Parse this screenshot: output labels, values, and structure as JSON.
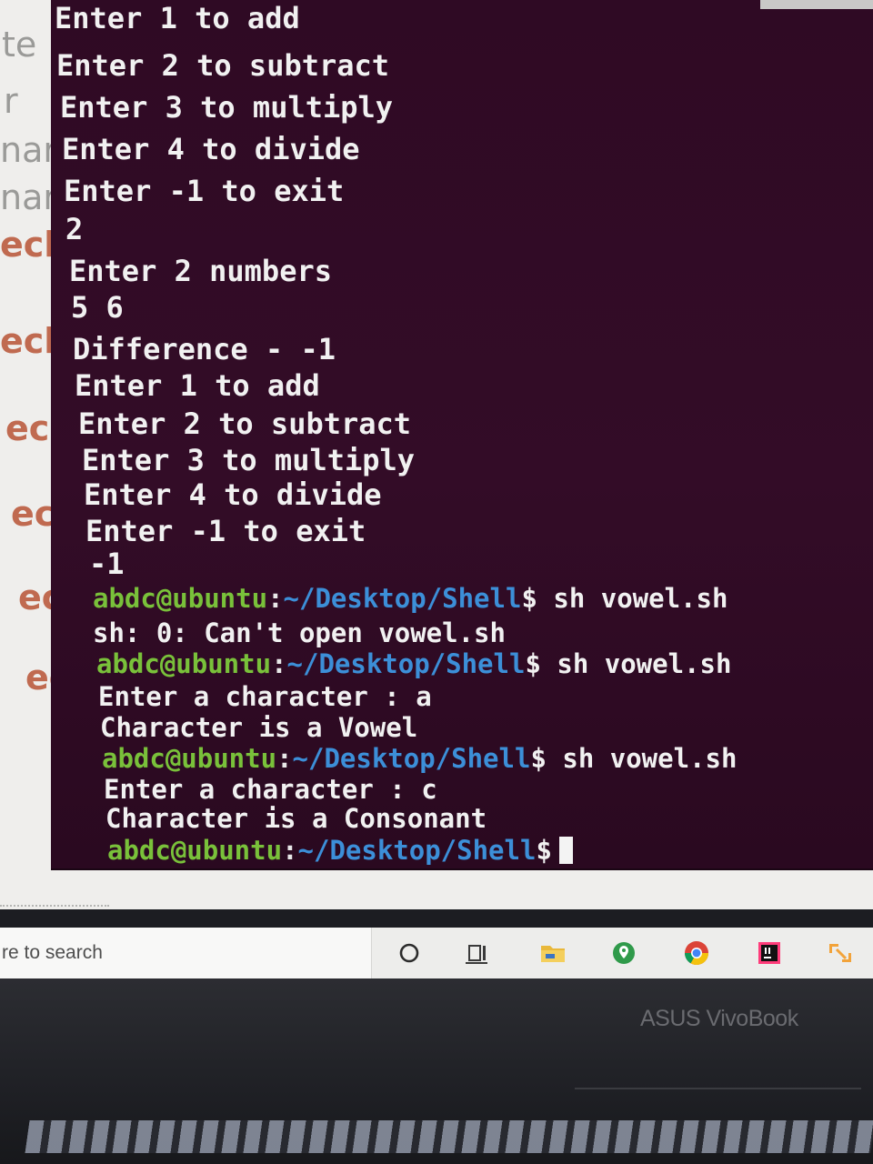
{
  "editor_fragments": [
    {
      "text": "te",
      "kind": "plain"
    },
    {
      "text": "r",
      "kind": "plain"
    },
    {
      "text": "nar",
      "kind": "plain"
    },
    {
      "text": "nar",
      "kind": "plain"
    },
    {
      "text": "ech",
      "kind": "echo"
    },
    {
      "text": "ech",
      "kind": "echo"
    },
    {
      "text": "ech",
      "kind": "echo"
    },
    {
      "text": "ech",
      "kind": "echo"
    },
    {
      "text": "ech",
      "kind": "echo"
    },
    {
      "text": "ech",
      "kind": "echo"
    }
  ],
  "terminal": {
    "lines": [
      {
        "type": "text",
        "text": "Enter 1 to add"
      },
      {
        "type": "text",
        "text": "Enter 2 to subtract"
      },
      {
        "type": "text",
        "text": "Enter 3 to multiply"
      },
      {
        "type": "text",
        "text": "Enter 4 to divide"
      },
      {
        "type": "text",
        "text": "Enter -1 to exit"
      },
      {
        "type": "text",
        "text": "2"
      },
      {
        "type": "text",
        "text": "Enter 2 numbers"
      },
      {
        "type": "text",
        "text": "5 6"
      },
      {
        "type": "text",
        "text": "Difference - -1"
      },
      {
        "type": "text",
        "text": "Enter 1 to add"
      },
      {
        "type": "text",
        "text": "Enter 2 to subtract"
      },
      {
        "type": "text",
        "text": "Enter 3 to multiply"
      },
      {
        "type": "text",
        "text": "Enter 4 to divide"
      },
      {
        "type": "text",
        "text": "Enter -1 to exit"
      },
      {
        "type": "text",
        "text": "-1"
      },
      {
        "type": "prompt",
        "user": "abdc@ubuntu",
        "path": "~/Desktop/Shell",
        "command": "sh vowel.sh"
      },
      {
        "type": "text",
        "text": "sh: 0: Can't open vowel.sh"
      },
      {
        "type": "prompt",
        "user": "abdc@ubuntu",
        "path": "~/Desktop/Shell",
        "command": "sh vowel.sh"
      },
      {
        "type": "text",
        "text": "Enter a character : a"
      },
      {
        "type": "text",
        "text": "Character is a Vowel"
      },
      {
        "type": "prompt",
        "user": "abdc@ubuntu",
        "path": "~/Desktop/Shell",
        "command": "sh vowel.sh"
      },
      {
        "type": "text",
        "text": "Enter a character : c"
      },
      {
        "type": "text",
        "text": "Character is a Consonant"
      },
      {
        "type": "prompt",
        "user": "abdc@ubuntu",
        "path": "~/Desktop/Shell",
        "command": "",
        "cursor": true
      }
    ],
    "prompt_colon": ":",
    "prompt_dollar": "$"
  },
  "taskbar": {
    "search_placeholder": "re to search",
    "icons": [
      {
        "name": "cortana-circle-icon"
      },
      {
        "name": "task-view-icon"
      },
      {
        "name": "file-explorer-icon"
      },
      {
        "name": "maps-app-icon"
      },
      {
        "name": "chrome-icon"
      },
      {
        "name": "intellij-icon"
      },
      {
        "name": "snip-tool-icon"
      }
    ]
  },
  "laptop": {
    "brand": "ASUS VivoBook"
  },
  "colors": {
    "terminal_bg": "#300a24",
    "prompt_user": "#79c13a",
    "prompt_path": "#3c8fd8",
    "text": "#f1f1f1"
  }
}
